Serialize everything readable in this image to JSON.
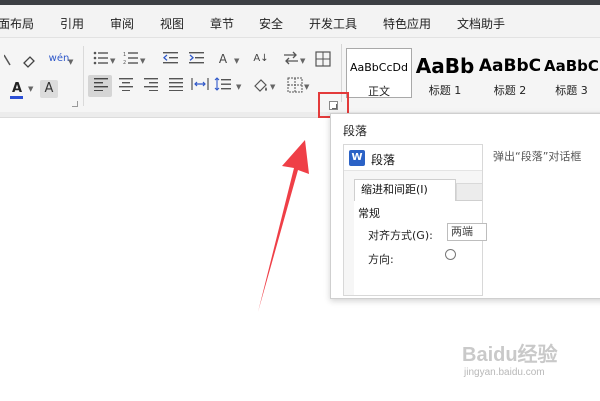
{
  "menubar": {
    "items": [
      "面布局",
      "引用",
      "审阅",
      "视图",
      "章节",
      "安全",
      "开发工具",
      "特色应用",
      "文档助手"
    ]
  },
  "ribbon": {
    "font_color_icon": "A",
    "font_char_icon": "A",
    "phonetic_icon": "wén",
    "sort_icon_text": "A↓",
    "text_direction_icon": "A",
    "styles": [
      {
        "sample": "AaBbCcDd",
        "label": "正文"
      },
      {
        "sample": "AaBb",
        "label": "标题 1"
      },
      {
        "sample": "AaBbC",
        "label": "标题 2"
      },
      {
        "sample": "AaBbC",
        "label": "标题 3"
      }
    ]
  },
  "tooltip": {
    "title": "段落",
    "description": "弹出“段落”对话框",
    "preview": {
      "logo": "W",
      "dialog_title": "段落",
      "tab_label": "缩进和间距(I)",
      "section": "常规",
      "align_label": "对齐方式(G):",
      "align_value": "两端",
      "direction_label": "方向:"
    }
  },
  "watermark": {
    "logo": "Baidu经验",
    "url": "jingyan.baidu.com"
  },
  "colors": {
    "highlight": "#e33a3a",
    "font_color_underline": "#2b4fd6",
    "wps_blue": "#2b62c6"
  }
}
